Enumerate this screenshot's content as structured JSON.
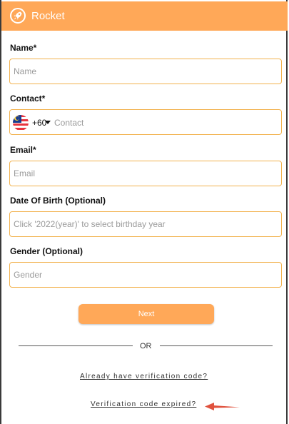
{
  "app": {
    "title": "Rocket",
    "logo_icon": "rocket-icon"
  },
  "form": {
    "name": {
      "label": "Name*",
      "placeholder": "Name"
    },
    "contact": {
      "label": "Contact*",
      "country_code": "+60",
      "placeholder": "Contact",
      "flag_icon": "malaysia-flag-icon"
    },
    "email": {
      "label": "Email*",
      "placeholder": "Email"
    },
    "dob": {
      "label": "Date Of Birth (Optional)",
      "placeholder": "Click '2022(year)' to select birthday year"
    },
    "gender": {
      "label": "Gender (Optional)",
      "placeholder": "Gender"
    },
    "next_label": "Next"
  },
  "divider": {
    "text": "OR"
  },
  "links": {
    "have_code": "Already have verification code?",
    "code_expired": "Verification code expired?"
  },
  "colors": {
    "accent": "#ffa858",
    "field_border": "#f2b24e",
    "annotation_arrow": "#e0523e"
  }
}
